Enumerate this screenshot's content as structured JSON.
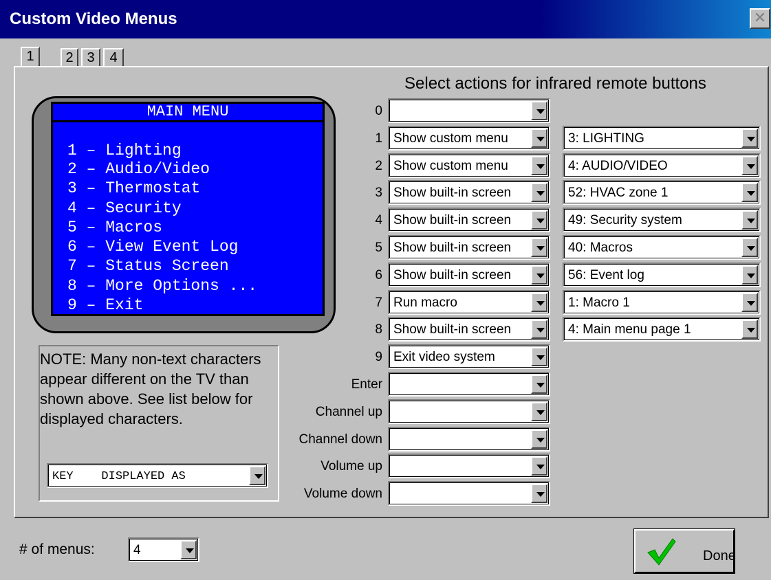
{
  "window": {
    "title": "Custom Video Menus",
    "close_symbol": "✕"
  },
  "tabs": [
    {
      "label": "1"
    },
    {
      "label": "2"
    },
    {
      "label": "3"
    },
    {
      "label": "4"
    }
  ],
  "heading": "Select actions for infrared remote buttons",
  "tv": {
    "title": "MAIN MENU",
    "lines": [
      "1 – Lighting",
      "2 – Audio/Video",
      "3 – Thermostat",
      "4 – Security",
      "5 – Macros",
      "6 – View Event Log",
      "7 – Status Screen",
      "8 – More Options ...",
      "9 – Exit"
    ]
  },
  "note": {
    "text": "NOTE:  Many non-text characters appear different on the TV than shown above. See list below for displayed characters.",
    "key_select": "KEY    DISPLAYED AS"
  },
  "buttons": [
    {
      "label": "0",
      "action": "",
      "target": ""
    },
    {
      "label": "1",
      "action": "Show custom menu",
      "target": "3: LIGHTING"
    },
    {
      "label": "2",
      "action": "Show custom menu",
      "target": "4: AUDIO/VIDEO"
    },
    {
      "label": "3",
      "action": "Show built-in screen",
      "target": "52: HVAC zone 1"
    },
    {
      "label": "4",
      "action": "Show built-in screen",
      "target": "49: Security system"
    },
    {
      "label": "5",
      "action": "Show built-in screen",
      "target": "40: Macros"
    },
    {
      "label": "6",
      "action": "Show built-in screen",
      "target": "56: Event log"
    },
    {
      "label": "7",
      "action": "Run macro",
      "target": "1: Macro 1"
    },
    {
      "label": "8",
      "action": "Show built-in screen",
      "target": "4: Main menu page 1"
    },
    {
      "label": "9",
      "action": "Exit video system",
      "target": ""
    },
    {
      "label": "Enter",
      "action": "",
      "target": ""
    },
    {
      "label": "Channel up",
      "action": "",
      "target": ""
    },
    {
      "label": "Channel down",
      "action": "",
      "target": ""
    },
    {
      "label": "Volume up",
      "action": "",
      "target": ""
    },
    {
      "label": "Volume down",
      "action": "",
      "target": ""
    }
  ],
  "footer": {
    "menus_label": "# of menus:",
    "menus_value": "4",
    "done_label": "Done"
  },
  "colors": {
    "title_bar": "#000080",
    "tv_screen": "#0000ff",
    "check": "#00c000"
  },
  "icons": {
    "check": "green-checkmark-icon"
  }
}
